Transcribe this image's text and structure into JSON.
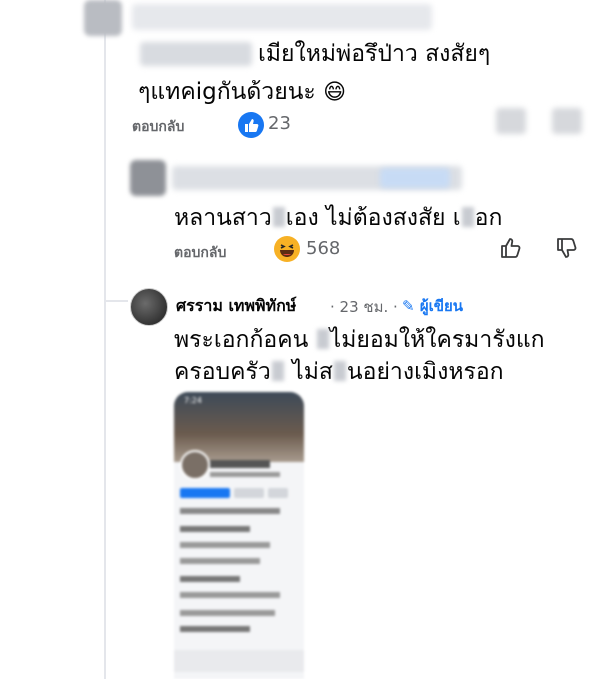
{
  "comments": [
    {
      "text_line1": "เมียใหม่พ่อรึป่าว สงสัยๆ",
      "text_line2": "ๆแทคigกันด้วยนะ",
      "emoji": "😄",
      "reply_label": "ตอบกลับ",
      "reaction_count": "23",
      "reaction_type": "like-icon",
      "accent": "#1877f2"
    },
    {
      "text_a": "หลานสาว",
      "text_b": "เอง ไม่ต้องสงสัย เ",
      "text_c": "อก",
      "reply_label": "ตอบกลับ",
      "reaction_count": "568",
      "reaction_type": "haha-icon",
      "reaction_color": "#f7b125"
    },
    {
      "author": "ศรราม เทพพิทักษ์",
      "time": "· 23 ชม. ·",
      "author_badge": "ผู้เขียน",
      "badge_color": "#1877f2",
      "text_line1_a": "พระเอกก้อคน",
      "text_line1_b": "ไม่ยอมให้ใครมารังแก",
      "text_line2_a": "ครอบครัว",
      "text_line2_b": "ไม่ส",
      "text_line2_c": "นอย่างเมิงหรอก",
      "attachment": "blurred-phone-screenshot"
    }
  ],
  "phone_status_time": "7:24"
}
